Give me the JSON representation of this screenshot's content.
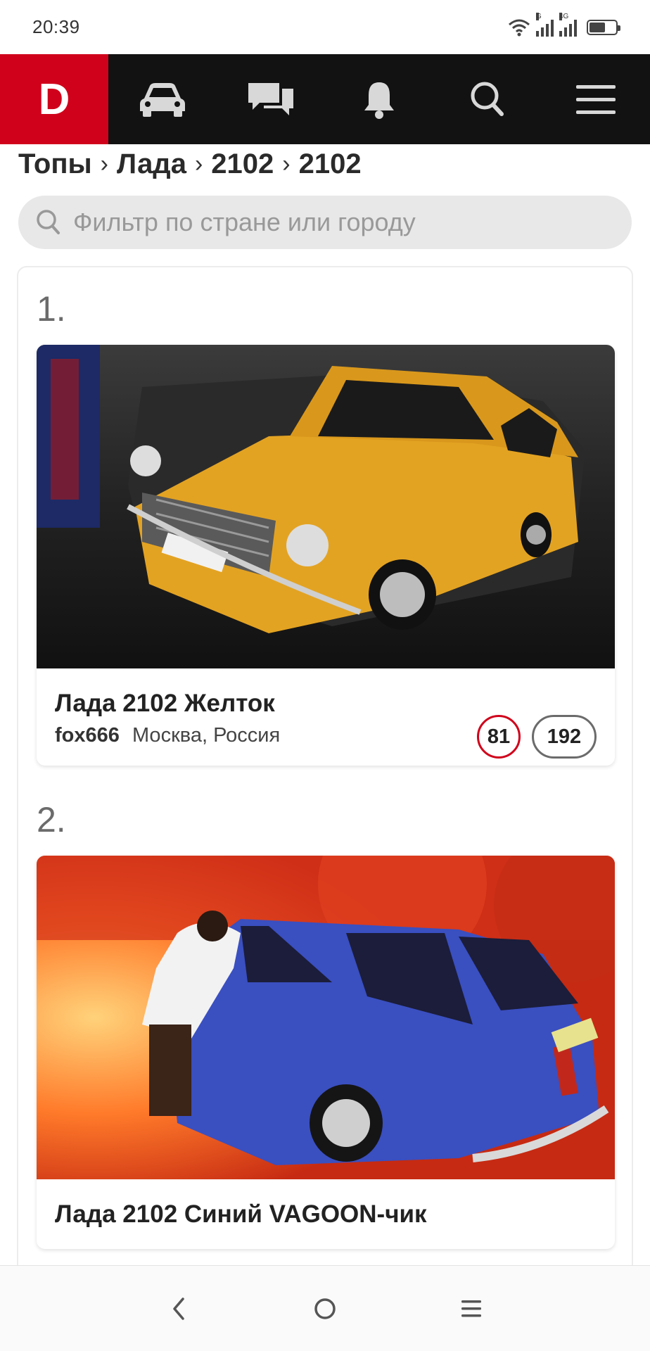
{
  "status_bar": {
    "time": "20:39",
    "net_tag_1": "G",
    "net_tag_2": "4G"
  },
  "nav": {
    "logo_letter": "D",
    "icons": [
      "car-icon",
      "chat-icon",
      "bell-icon",
      "search-icon",
      "menu-icon"
    ],
    "brand_color": "#d0021b"
  },
  "breadcrumb": {
    "items": [
      "Топы",
      "Лада",
      "2102",
      "2102"
    ],
    "separator": "›"
  },
  "filter": {
    "placeholder": "Фильтр по стране или городу",
    "value": ""
  },
  "entries": [
    {
      "rank": "1.",
      "title": "Лада 2102 Желток",
      "user": "fox666",
      "location": "Москва, Россия",
      "badge_red": "81",
      "badge_grey": "192",
      "car_color": "#e3a322"
    },
    {
      "rank": "2.",
      "title": "Лада 2102 Синий VAGOON-чик",
      "car_color": "#3a4fc0"
    }
  ]
}
